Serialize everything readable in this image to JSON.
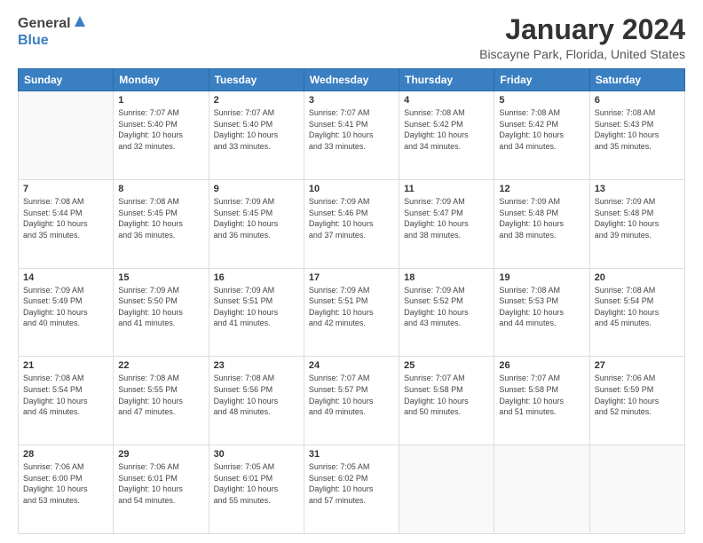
{
  "logo": {
    "general": "General",
    "blue": "Blue"
  },
  "header": {
    "title": "January 2024",
    "subtitle": "Biscayne Park, Florida, United States"
  },
  "calendar": {
    "days_of_week": [
      "Sunday",
      "Monday",
      "Tuesday",
      "Wednesday",
      "Thursday",
      "Friday",
      "Saturday"
    ],
    "weeks": [
      [
        {
          "day": "",
          "info": ""
        },
        {
          "day": "1",
          "info": "Sunrise: 7:07 AM\nSunset: 5:40 PM\nDaylight: 10 hours\nand 32 minutes."
        },
        {
          "day": "2",
          "info": "Sunrise: 7:07 AM\nSunset: 5:40 PM\nDaylight: 10 hours\nand 33 minutes."
        },
        {
          "day": "3",
          "info": "Sunrise: 7:07 AM\nSunset: 5:41 PM\nDaylight: 10 hours\nand 33 minutes."
        },
        {
          "day": "4",
          "info": "Sunrise: 7:08 AM\nSunset: 5:42 PM\nDaylight: 10 hours\nand 34 minutes."
        },
        {
          "day": "5",
          "info": "Sunrise: 7:08 AM\nSunset: 5:42 PM\nDaylight: 10 hours\nand 34 minutes."
        },
        {
          "day": "6",
          "info": "Sunrise: 7:08 AM\nSunset: 5:43 PM\nDaylight: 10 hours\nand 35 minutes."
        }
      ],
      [
        {
          "day": "7",
          "info": "Sunrise: 7:08 AM\nSunset: 5:44 PM\nDaylight: 10 hours\nand 35 minutes."
        },
        {
          "day": "8",
          "info": "Sunrise: 7:08 AM\nSunset: 5:45 PM\nDaylight: 10 hours\nand 36 minutes."
        },
        {
          "day": "9",
          "info": "Sunrise: 7:09 AM\nSunset: 5:45 PM\nDaylight: 10 hours\nand 36 minutes."
        },
        {
          "day": "10",
          "info": "Sunrise: 7:09 AM\nSunset: 5:46 PM\nDaylight: 10 hours\nand 37 minutes."
        },
        {
          "day": "11",
          "info": "Sunrise: 7:09 AM\nSunset: 5:47 PM\nDaylight: 10 hours\nand 38 minutes."
        },
        {
          "day": "12",
          "info": "Sunrise: 7:09 AM\nSunset: 5:48 PM\nDaylight: 10 hours\nand 38 minutes."
        },
        {
          "day": "13",
          "info": "Sunrise: 7:09 AM\nSunset: 5:48 PM\nDaylight: 10 hours\nand 39 minutes."
        }
      ],
      [
        {
          "day": "14",
          "info": "Sunrise: 7:09 AM\nSunset: 5:49 PM\nDaylight: 10 hours\nand 40 minutes."
        },
        {
          "day": "15",
          "info": "Sunrise: 7:09 AM\nSunset: 5:50 PM\nDaylight: 10 hours\nand 41 minutes."
        },
        {
          "day": "16",
          "info": "Sunrise: 7:09 AM\nSunset: 5:51 PM\nDaylight: 10 hours\nand 41 minutes."
        },
        {
          "day": "17",
          "info": "Sunrise: 7:09 AM\nSunset: 5:51 PM\nDaylight: 10 hours\nand 42 minutes."
        },
        {
          "day": "18",
          "info": "Sunrise: 7:09 AM\nSunset: 5:52 PM\nDaylight: 10 hours\nand 43 minutes."
        },
        {
          "day": "19",
          "info": "Sunrise: 7:08 AM\nSunset: 5:53 PM\nDaylight: 10 hours\nand 44 minutes."
        },
        {
          "day": "20",
          "info": "Sunrise: 7:08 AM\nSunset: 5:54 PM\nDaylight: 10 hours\nand 45 minutes."
        }
      ],
      [
        {
          "day": "21",
          "info": "Sunrise: 7:08 AM\nSunset: 5:54 PM\nDaylight: 10 hours\nand 46 minutes."
        },
        {
          "day": "22",
          "info": "Sunrise: 7:08 AM\nSunset: 5:55 PM\nDaylight: 10 hours\nand 47 minutes."
        },
        {
          "day": "23",
          "info": "Sunrise: 7:08 AM\nSunset: 5:56 PM\nDaylight: 10 hours\nand 48 minutes."
        },
        {
          "day": "24",
          "info": "Sunrise: 7:07 AM\nSunset: 5:57 PM\nDaylight: 10 hours\nand 49 minutes."
        },
        {
          "day": "25",
          "info": "Sunrise: 7:07 AM\nSunset: 5:58 PM\nDaylight: 10 hours\nand 50 minutes."
        },
        {
          "day": "26",
          "info": "Sunrise: 7:07 AM\nSunset: 5:58 PM\nDaylight: 10 hours\nand 51 minutes."
        },
        {
          "day": "27",
          "info": "Sunrise: 7:06 AM\nSunset: 5:59 PM\nDaylight: 10 hours\nand 52 minutes."
        }
      ],
      [
        {
          "day": "28",
          "info": "Sunrise: 7:06 AM\nSunset: 6:00 PM\nDaylight: 10 hours\nand 53 minutes."
        },
        {
          "day": "29",
          "info": "Sunrise: 7:06 AM\nSunset: 6:01 PM\nDaylight: 10 hours\nand 54 minutes."
        },
        {
          "day": "30",
          "info": "Sunrise: 7:05 AM\nSunset: 6:01 PM\nDaylight: 10 hours\nand 55 minutes."
        },
        {
          "day": "31",
          "info": "Sunrise: 7:05 AM\nSunset: 6:02 PM\nDaylight: 10 hours\nand 57 minutes."
        },
        {
          "day": "",
          "info": ""
        },
        {
          "day": "",
          "info": ""
        },
        {
          "day": "",
          "info": ""
        }
      ]
    ]
  }
}
